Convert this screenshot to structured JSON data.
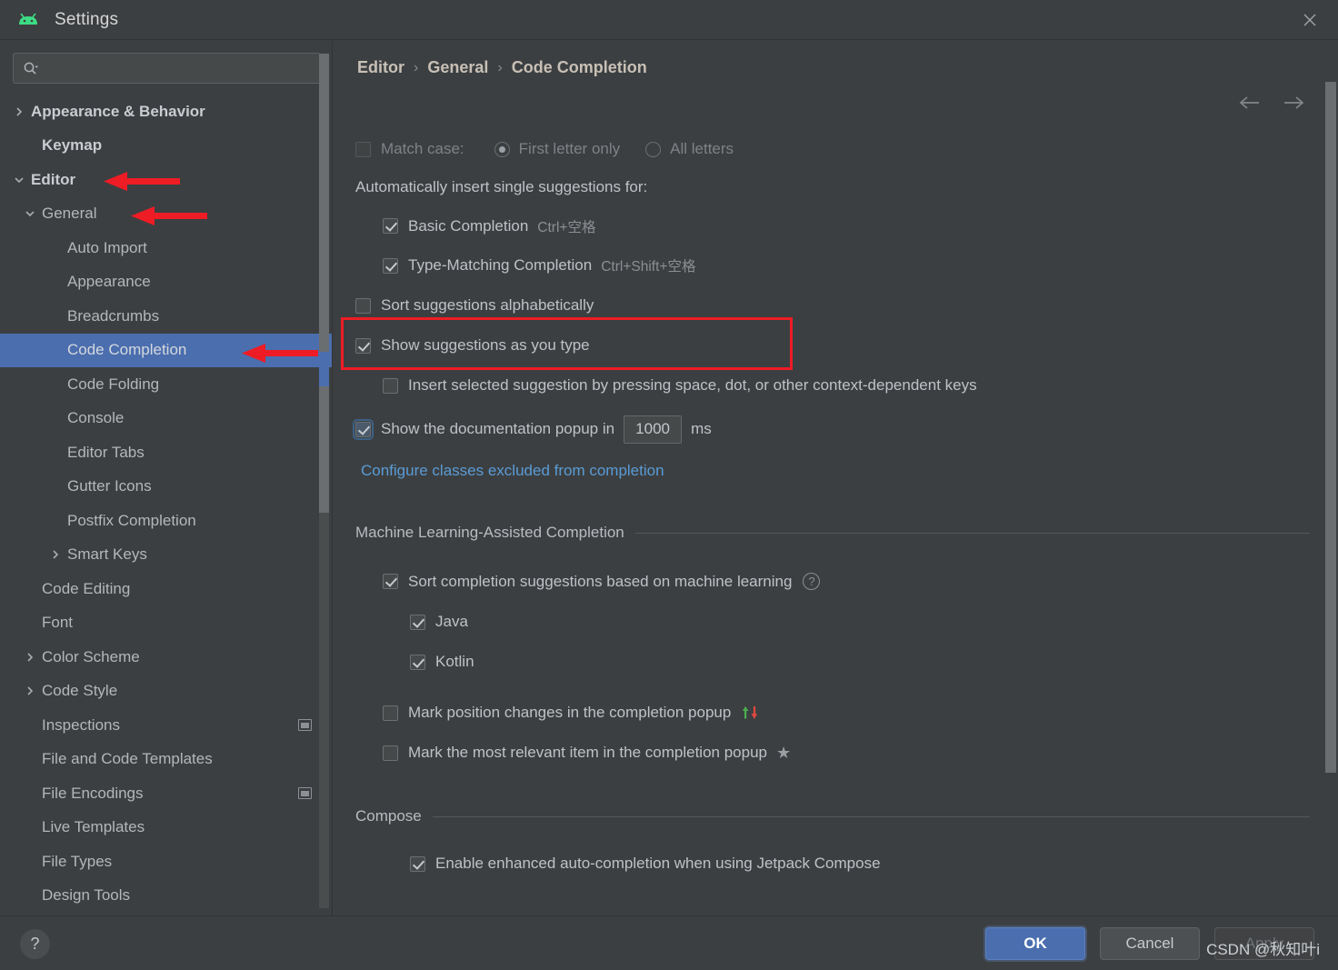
{
  "window": {
    "title": "Settings",
    "app_icon": "android-logo-icon",
    "close_icon": "close-icon"
  },
  "sidebar": {
    "search": {
      "placeholder": "",
      "value": "",
      "icon": "search-icon"
    },
    "items": [
      {
        "label": "Appearance & Behavior",
        "indent": 0,
        "twisty": "right",
        "bold": true,
        "selected": false
      },
      {
        "label": "Keymap",
        "indent": 1,
        "twisty": "none",
        "bold": true,
        "selected": false
      },
      {
        "label": "Editor",
        "indent": 0,
        "twisty": "down",
        "bold": true,
        "selected": false,
        "annotated": true
      },
      {
        "label": "General",
        "indent": 1,
        "twisty": "down",
        "bold": false,
        "selected": false,
        "annotated": true
      },
      {
        "label": "Auto Import",
        "indent": 2,
        "twisty": "none",
        "bold": false,
        "selected": false
      },
      {
        "label": "Appearance",
        "indent": 2,
        "twisty": "none",
        "bold": false,
        "selected": false
      },
      {
        "label": "Breadcrumbs",
        "indent": 2,
        "twisty": "none",
        "bold": false,
        "selected": false
      },
      {
        "label": "Code Completion",
        "indent": 2,
        "twisty": "none",
        "bold": false,
        "selected": true,
        "annotated": true
      },
      {
        "label": "Code Folding",
        "indent": 2,
        "twisty": "none",
        "bold": false,
        "selected": false
      },
      {
        "label": "Console",
        "indent": 2,
        "twisty": "none",
        "bold": false,
        "selected": false
      },
      {
        "label": "Editor Tabs",
        "indent": 2,
        "twisty": "none",
        "bold": false,
        "selected": false
      },
      {
        "label": "Gutter Icons",
        "indent": 2,
        "twisty": "none",
        "bold": false,
        "selected": false
      },
      {
        "label": "Postfix Completion",
        "indent": 2,
        "twisty": "none",
        "bold": false,
        "selected": false
      },
      {
        "label": "Smart Keys",
        "indent": 2,
        "twisty": "right",
        "bold": false,
        "selected": false
      },
      {
        "label": "Code Editing",
        "indent": 1,
        "twisty": "none",
        "bold": false,
        "selected": false
      },
      {
        "label": "Font",
        "indent": 1,
        "twisty": "none",
        "bold": false,
        "selected": false
      },
      {
        "label": "Color Scheme",
        "indent": 1,
        "twisty": "right",
        "bold": false,
        "selected": false
      },
      {
        "label": "Code Style",
        "indent": 1,
        "twisty": "right",
        "bold": false,
        "selected": false
      },
      {
        "label": "Inspections",
        "indent": 1,
        "twisty": "none",
        "bold": false,
        "selected": false,
        "config_icon": true
      },
      {
        "label": "File and Code Templates",
        "indent": 1,
        "twisty": "none",
        "bold": false,
        "selected": false
      },
      {
        "label": "File Encodings",
        "indent": 1,
        "twisty": "none",
        "bold": false,
        "selected": false,
        "config_icon": true
      },
      {
        "label": "Live Templates",
        "indent": 1,
        "twisty": "none",
        "bold": false,
        "selected": false
      },
      {
        "label": "File Types",
        "indent": 1,
        "twisty": "none",
        "bold": false,
        "selected": false
      },
      {
        "label": "Design Tools",
        "indent": 1,
        "twisty": "none",
        "bold": false,
        "selected": false
      }
    ]
  },
  "breadcrumb": {
    "items": [
      "Editor",
      "General",
      "Code Completion"
    ],
    "separator": "›",
    "back_icon": "arrow-left-icon",
    "forward_icon": "arrow-right-icon"
  },
  "main": {
    "match_case": {
      "label": "Match case:",
      "checked": false,
      "disabled": true,
      "options": [
        {
          "label": "First letter only",
          "selected": true
        },
        {
          "label": "All letters",
          "selected": false
        }
      ]
    },
    "auto_insert_header": "Automatically insert single suggestions for:",
    "auto_insert_items": [
      {
        "label": "Basic Completion",
        "shortcut": "Ctrl+空格",
        "checked": true
      },
      {
        "label": "Type-Matching Completion",
        "shortcut": "Ctrl+Shift+空格",
        "checked": true
      }
    ],
    "sort_alphabetically": {
      "label": "Sort suggestions alphabetically",
      "checked": false
    },
    "show_as_you_type": {
      "label": "Show suggestions as you type",
      "checked": true
    },
    "insert_selected": {
      "label": "Insert selected suggestion by pressing space, dot, or other context-dependent keys",
      "checked": false
    },
    "doc_popup": {
      "label_before": "Show the documentation popup in",
      "value": "1000",
      "unit": "ms",
      "checked": true,
      "highlighted": true
    },
    "excluded_link": "Configure classes excluded from completion",
    "ml_section": {
      "title": "Machine Learning-Assisted Completion",
      "sort_ml": {
        "label": "Sort completion suggestions based on machine learning",
        "checked": true,
        "help_icon": "help-icon"
      },
      "languages": [
        {
          "label": "Java",
          "checked": true
        },
        {
          "label": "Kotlin",
          "checked": true
        }
      ],
      "mark_position": {
        "label": "Mark position changes in the completion popup",
        "checked": false,
        "icon": "up-down-arrows-icon"
      },
      "mark_relevant": {
        "label": "Mark the most relevant item in the completion popup",
        "checked": false,
        "icon": "star-icon"
      }
    },
    "compose_section": {
      "title": "Compose",
      "enable_enhanced": {
        "label": "Enable enhanced auto-completion when using Jetpack Compose",
        "checked": true
      }
    }
  },
  "footer": {
    "help_label": "?",
    "buttons": [
      {
        "label": "OK",
        "style": "primary",
        "enabled": true
      },
      {
        "label": "Cancel",
        "style": "default",
        "enabled": true
      },
      {
        "label": "Apply",
        "style": "disabled",
        "enabled": false
      }
    ]
  },
  "watermark": "CSDN @秋知叶i",
  "colors": {
    "accent": "#4b6eaf",
    "link": "#5a9bd5",
    "annotation": "#ee1c25",
    "background": "#3c3f41",
    "android_green": "#3ddc84"
  }
}
